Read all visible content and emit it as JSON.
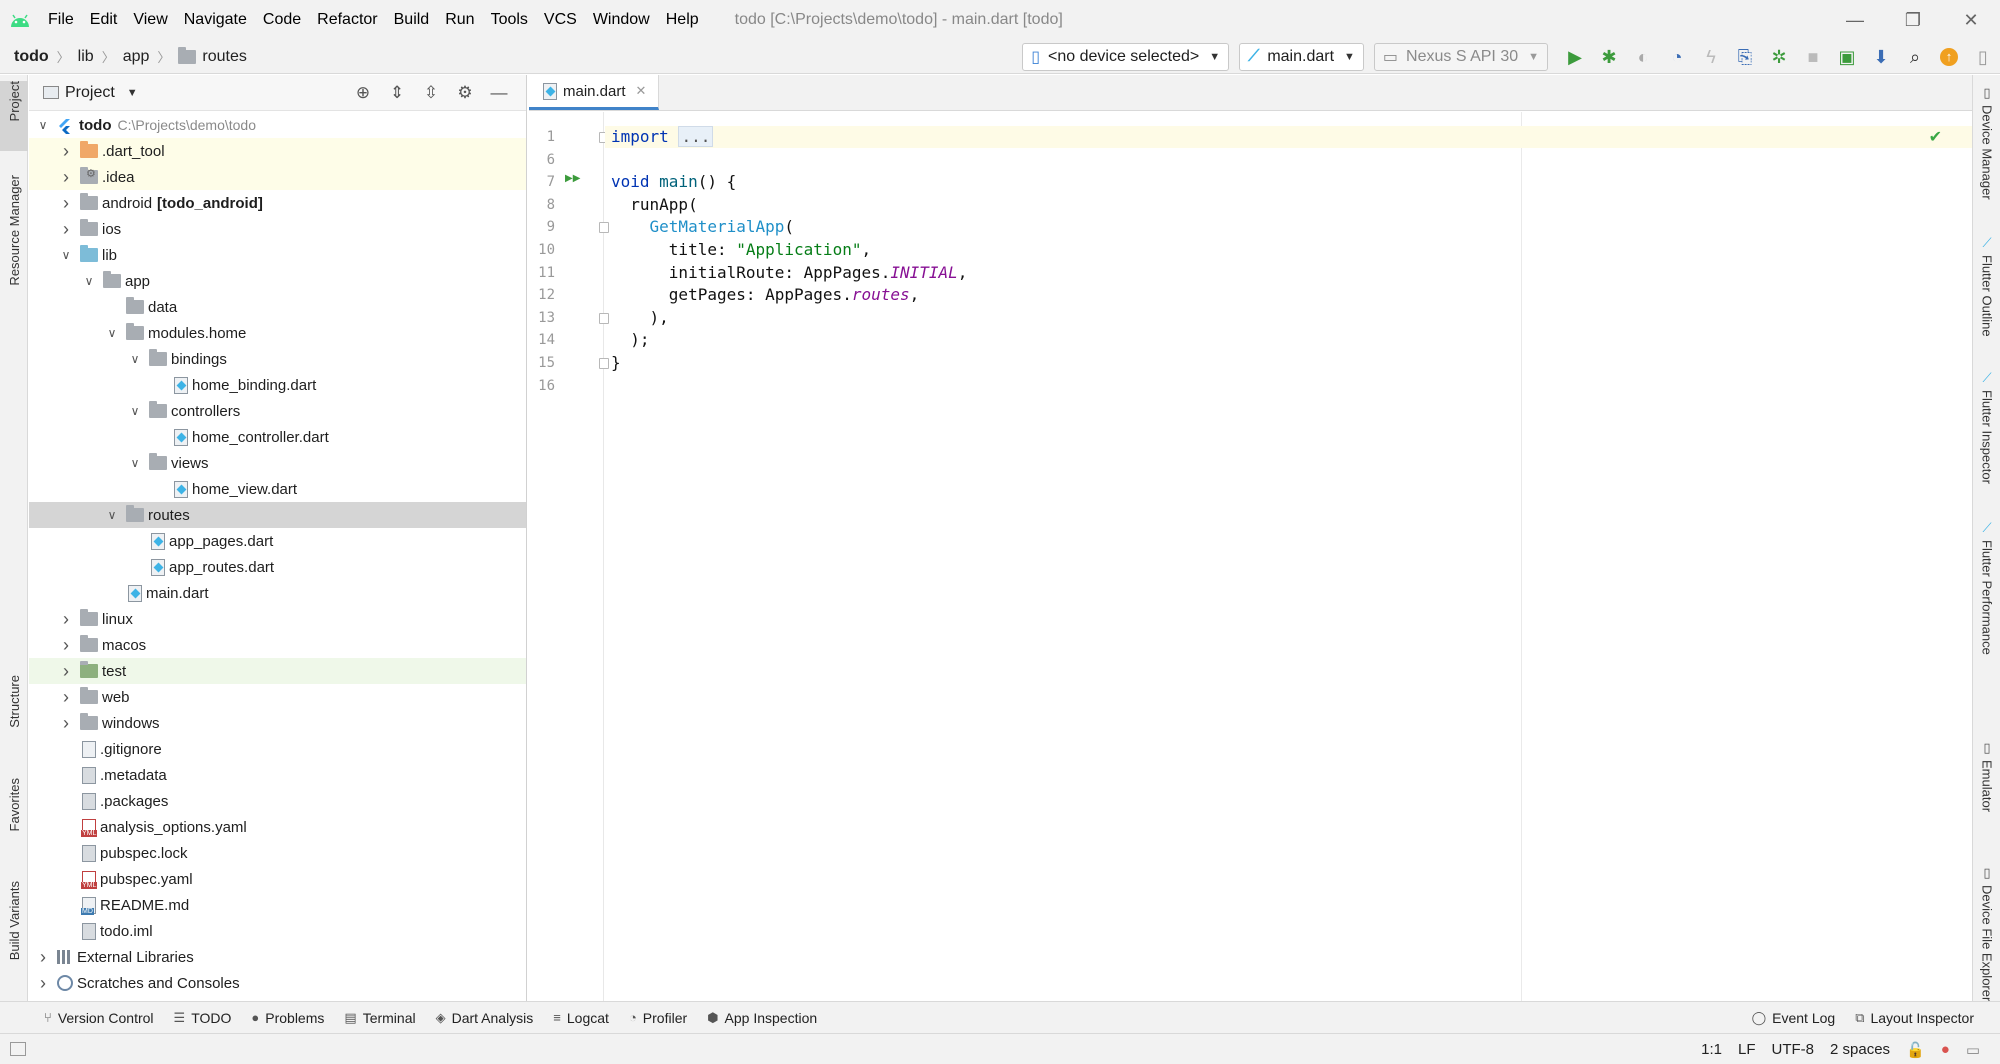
{
  "window": {
    "title": "todo [C:\\Projects\\demo\\todo] - main.dart [todo]"
  },
  "menu": [
    "File",
    "Edit",
    "View",
    "Navigate",
    "Code",
    "Refactor",
    "Build",
    "Run",
    "Tools",
    "VCS",
    "Window",
    "Help"
  ],
  "breadcrumb": [
    "todo",
    "lib",
    "app",
    "routes"
  ],
  "toolbar": {
    "device": "<no device selected>",
    "config": "main.dart",
    "emulator": "Nexus S API 30"
  },
  "left_tabs": [
    "Project",
    "Resource Manager",
    "Structure",
    "Favorites",
    "Build Variants"
  ],
  "right_tabs": [
    "Device Manager",
    "Flutter Outline",
    "Flutter Inspector",
    "Flutter Performance",
    "Emulator",
    "Device File Explorer"
  ],
  "project": {
    "title": "Project",
    "tree": [
      {
        "label": "todo",
        "path": "C:\\Projects\\demo\\todo",
        "depth": 0,
        "chev": "down",
        "icon": "flutter-module",
        "bold": true
      },
      {
        "label": ".dart_tool",
        "depth": 1,
        "chev": "right",
        "icon": "folder-orange",
        "hl": "yellow"
      },
      {
        "label": ".idea",
        "depth": 1,
        "chev": "right",
        "icon": "folder-gear",
        "hl": "yellow"
      },
      {
        "label": "android",
        "suffix": "[todo_android]",
        "depth": 1,
        "chev": "right",
        "icon": "folder"
      },
      {
        "label": "ios",
        "depth": 1,
        "chev": "right",
        "icon": "folder"
      },
      {
        "label": "lib",
        "depth": 1,
        "chev": "down",
        "icon": "folder-blue"
      },
      {
        "label": "app",
        "depth": 2,
        "chev": "down",
        "icon": "folder"
      },
      {
        "label": "data",
        "depth": 3,
        "chev": "none",
        "icon": "folder"
      },
      {
        "label": "modules.home",
        "depth": 3,
        "chev": "down",
        "icon": "folder"
      },
      {
        "label": "bindings",
        "depth": 4,
        "chev": "down",
        "icon": "folder"
      },
      {
        "label": "home_binding.dart",
        "depth": 5,
        "chev": "none",
        "icon": "dart"
      },
      {
        "label": "controllers",
        "depth": 4,
        "chev": "down",
        "icon": "folder"
      },
      {
        "label": "home_controller.dart",
        "depth": 5,
        "chev": "none",
        "icon": "dart"
      },
      {
        "label": "views",
        "depth": 4,
        "chev": "down",
        "icon": "folder"
      },
      {
        "label": "home_view.dart",
        "depth": 5,
        "chev": "none",
        "icon": "dart"
      },
      {
        "label": "routes",
        "depth": 3,
        "chev": "down",
        "icon": "folder",
        "hl": "selected"
      },
      {
        "label": "app_pages.dart",
        "depth": 4,
        "chev": "none",
        "icon": "dart"
      },
      {
        "label": "app_routes.dart",
        "depth": 4,
        "chev": "none",
        "icon": "dart"
      },
      {
        "label": "main.dart",
        "depth": 3,
        "chev": "none",
        "icon": "dart"
      },
      {
        "label": "linux",
        "depth": 1,
        "chev": "right",
        "icon": "folder"
      },
      {
        "label": "macos",
        "depth": 1,
        "chev": "right",
        "icon": "folder"
      },
      {
        "label": "test",
        "depth": 1,
        "chev": "right",
        "icon": "folder-test",
        "hl": "green"
      },
      {
        "label": "web",
        "depth": 1,
        "chev": "right",
        "icon": "folder-web"
      },
      {
        "label": "windows",
        "depth": 1,
        "chev": "right",
        "icon": "folder"
      },
      {
        "label": ".gitignore",
        "depth": 1,
        "chev": "none",
        "icon": "file"
      },
      {
        "label": ".metadata",
        "depth": 1,
        "chev": "none",
        "icon": "file-plain"
      },
      {
        "label": ".packages",
        "depth": 1,
        "chev": "none",
        "icon": "file-plain"
      },
      {
        "label": "analysis_options.yaml",
        "depth": 1,
        "chev": "none",
        "icon": "yml"
      },
      {
        "label": "pubspec.lock",
        "depth": 1,
        "chev": "none",
        "icon": "file-plain"
      },
      {
        "label": "pubspec.yaml",
        "depth": 1,
        "chev": "none",
        "icon": "yml"
      },
      {
        "label": "README.md",
        "depth": 1,
        "chev": "none",
        "icon": "md"
      },
      {
        "label": "todo.iml",
        "depth": 1,
        "chev": "none",
        "icon": "file-plain"
      },
      {
        "label": "External Libraries",
        "depth": 0,
        "chev": "right",
        "icon": "libraries"
      },
      {
        "label": "Scratches and Consoles",
        "depth": 0,
        "chev": "right",
        "icon": "scratches"
      }
    ]
  },
  "editor": {
    "tab": "main.dart",
    "lines": [
      {
        "n": "1",
        "html": "<span class=\"kw\">import</span> <span class=\"folded\">...</span>",
        "current": true
      },
      {
        "n": "6",
        "html": ""
      },
      {
        "n": "7",
        "html": "<span class=\"kw\">void</span> <span class=\"fn\">main</span>() {"
      },
      {
        "n": "8",
        "html": "  runApp("
      },
      {
        "n": "9",
        "html": "    <span class=\"cls\">GetMaterialApp</span>("
      },
      {
        "n": "10",
        "html": "      title: <span class=\"str\">\"Application\"</span>,"
      },
      {
        "n": "11",
        "html": "      initialRoute: AppPages.<span class=\"const\">INITIAL</span>,"
      },
      {
        "n": "12",
        "html": "      getPages: AppPages.<span class=\"const\">routes</span>,"
      },
      {
        "n": "13",
        "html": "    ),"
      },
      {
        "n": "14",
        "html": "  );"
      },
      {
        "n": "15",
        "html": "}"
      },
      {
        "n": "16",
        "html": ""
      }
    ]
  },
  "bottom_tools": [
    "Version Control",
    "TODO",
    "Problems",
    "Terminal",
    "Dart Analysis",
    "Logcat",
    "Profiler",
    "App Inspection"
  ],
  "bottom_right": [
    "Event Log",
    "Layout Inspector"
  ],
  "status": {
    "position": "1:1",
    "line_sep": "LF",
    "encoding": "UTF-8",
    "indent": "2 spaces"
  }
}
